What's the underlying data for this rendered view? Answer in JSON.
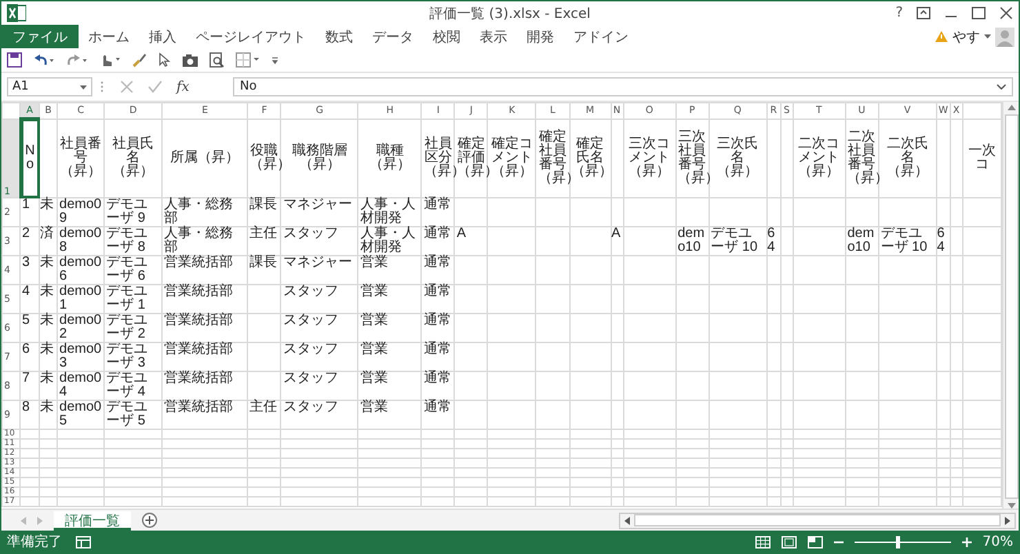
{
  "window": {
    "title": "評価一覧 (3).xlsx - Excel",
    "help": "?"
  },
  "ribbon_tabs": [
    {
      "label": "ファイル",
      "kind": "file",
      "selected": false
    },
    {
      "label": "ホーム",
      "kind": "tab",
      "selected": false
    },
    {
      "label": "挿入",
      "kind": "tab",
      "selected": false
    },
    {
      "label": "ページレイアウト",
      "kind": "tab",
      "selected": false
    },
    {
      "label": "数式",
      "kind": "tab",
      "selected": false
    },
    {
      "label": "データ",
      "kind": "tab",
      "selected": false
    },
    {
      "label": "校閲",
      "kind": "tab",
      "selected": false
    },
    {
      "label": "表示",
      "kind": "tab",
      "selected": false
    },
    {
      "label": "開発",
      "kind": "tab",
      "selected": false
    },
    {
      "label": "アドイン",
      "kind": "tab",
      "selected": false
    }
  ],
  "user": {
    "name": "やす"
  },
  "formula_bar": {
    "name_box": "A1",
    "fx": "fx",
    "value": "No"
  },
  "columns": [
    {
      "letter": "A",
      "selected": true
    },
    {
      "letter": "B",
      "selected": false
    },
    {
      "letter": "C",
      "selected": false
    },
    {
      "letter": "D",
      "selected": false
    },
    {
      "letter": "E",
      "selected": false
    },
    {
      "letter": "F",
      "selected": false
    },
    {
      "letter": "G",
      "selected": false
    },
    {
      "letter": "H",
      "selected": false
    },
    {
      "letter": "I",
      "selected": false
    },
    {
      "letter": "J",
      "selected": false
    },
    {
      "letter": "K",
      "selected": false
    },
    {
      "letter": "L",
      "selected": false
    },
    {
      "letter": "M",
      "selected": false
    },
    {
      "letter": "N",
      "selected": false
    },
    {
      "letter": "O",
      "selected": false
    },
    {
      "letter": "P",
      "selected": false
    },
    {
      "letter": "Q",
      "selected": false
    },
    {
      "letter": "R",
      "selected": false
    },
    {
      "letter": "S",
      "selected": false
    },
    {
      "letter": "T",
      "selected": false
    },
    {
      "letter": "U",
      "selected": false
    },
    {
      "letter": "V",
      "selected": false
    },
    {
      "letter": "W",
      "selected": false
    },
    {
      "letter": "X",
      "selected": false
    }
  ],
  "header_row": {
    "number": "1",
    "selected": true,
    "cells": {
      "A": "No",
      "C": "社員番号（昇）",
      "D": "社員氏名（昇）",
      "E": "所属（昇）",
      "F": "役職（昇）",
      "G": "職務階層（昇）",
      "H": "職種（昇）",
      "I": "社員区分（昇）",
      "J": "確定評価（昇）",
      "K": "確定コメント（昇）",
      "L": "確定社員番号（昇）",
      "M": "確定氏名（昇）",
      "O": "三次コメント（昇）",
      "P": "三次社員番号（昇）",
      "Q": "三次氏名（昇）",
      "T": "二次コメント（昇）",
      "U": "二次社員番号（昇）",
      "V": "二次氏名（昇）",
      "column_25": "一次コ"
    }
  },
  "rows": [
    {
      "number": "2",
      "cells": {
        "A": "1",
        "B": "未",
        "C": "demo09",
        "D": "デモユーザ 9",
        "E": "人事・総務部",
        "F": "課長",
        "G": "マネジャー",
        "H": "人事・人材開発",
        "I": "通常"
      }
    },
    {
      "number": "3",
      "cells": {
        "A": "2",
        "B": "済",
        "C": "demo08",
        "D": "デモユーザ 8",
        "E": "人事・総務部",
        "F": "主任",
        "G": "スタッフ",
        "H": "人事・人材開発",
        "I": "通常",
        "J": "A",
        "N": "A",
        "P": "demo10",
        "Q": "デモユーザ 10",
        "R": "64",
        "U": "demo10",
        "V": "デモユーザ 10",
        "W": "64"
      }
    },
    {
      "number": "4",
      "cells": {
        "A": "3",
        "B": "未",
        "C": "demo06",
        "D": "デモユーザ 6",
        "E": "営業統括部",
        "F": "課長",
        "G": "マネジャー",
        "H": "営業",
        "I": "通常"
      }
    },
    {
      "number": "5",
      "cells": {
        "A": "4",
        "B": "未",
        "C": "demo01",
        "D": "デモユーザ 1",
        "E": "営業統括部",
        "G": "スタッフ",
        "H": "営業",
        "I": "通常"
      }
    },
    {
      "number": "6",
      "cells": {
        "A": "5",
        "B": "未",
        "C": "demo02",
        "D": "デモユーザ 2",
        "E": "営業統括部",
        "G": "スタッフ",
        "H": "営業",
        "I": "通常"
      }
    },
    {
      "number": "7",
      "cells": {
        "A": "6",
        "B": "未",
        "C": "demo03",
        "D": "デモユーザ 3",
        "E": "営業統括部",
        "G": "スタッフ",
        "H": "営業",
        "I": "通常"
      }
    },
    {
      "number": "8",
      "cells": {
        "A": "7",
        "B": "未",
        "C": "demo04",
        "D": "デモユーザ 4",
        "E": "営業統括部",
        "G": "スタッフ",
        "H": "営業",
        "I": "通常"
      }
    },
    {
      "number": "9",
      "cells": {
        "A": "8",
        "B": "未",
        "C": "demo05",
        "D": "デモユーザ 5",
        "E": "営業統括部",
        "F": "主任",
        "G": "スタッフ",
        "H": "営業",
        "I": "通常"
      }
    }
  ],
  "empty_rows": [
    "10",
    "11",
    "12",
    "13",
    "14",
    "15",
    "16",
    "17"
  ],
  "sheet_tabs": [
    {
      "label": "評価一覧",
      "selected": true
    }
  ],
  "status_bar": {
    "status": "準備完了",
    "zoom": "70%",
    "zoom_slider": {
      "level": 0.45
    }
  }
}
